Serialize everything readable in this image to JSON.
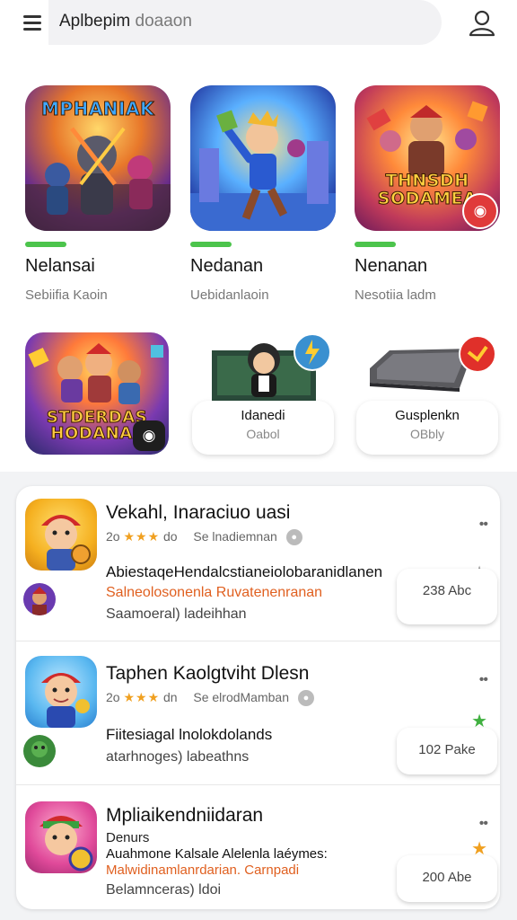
{
  "header": {
    "search_value": "Aplbepim",
    "search_placeholder": "doaaon"
  },
  "featured": [
    {
      "tile_text": "MPHANIAK",
      "name": "Nelansai",
      "sub": "Sebiifia Kaoin",
      "progress": 0.3
    },
    {
      "tile_text": "",
      "name": "Nedanan",
      "sub": "Uebidanlaoin",
      "progress": 0.3
    },
    {
      "tile_text": "THNSDH SODAMEA",
      "name": "Nenanan",
      "sub": "Nesotiia ladm",
      "progress": 0.3
    }
  ],
  "row2": {
    "tile_text": "STDERDAS HODANAL",
    "promos": [
      {
        "title": "Idanedi",
        "sub": "Oabol"
      },
      {
        "title": "Gusplenkn",
        "sub": "OBbly"
      }
    ]
  },
  "apps": [
    {
      "title": "Vekahl, Inaraciuo uasi",
      "rating_num": "2o",
      "meta_a": "do",
      "meta_b": "Se lnadiemnan",
      "desc1": "AbiestaqeHendalcstianeiolobaranidlanen",
      "desc2": "Salneolosonenla Ruvatenenranan",
      "desc3": "Saamoeral) ladeihhan",
      "price": "238 Abc"
    },
    {
      "title": "Taphen Kaolgtviht Dlesn",
      "rating_num": "2o",
      "meta_a": "dn",
      "meta_b": "Se elrodMamban",
      "desc1": "Fiitesiagal lnolokdolands",
      "desc2": "",
      "desc3": "atarhnoges) labeathns",
      "price": "102 Pake"
    },
    {
      "title": "Mpliaikendniidaran",
      "rating_num": "Denurs",
      "meta_a": "",
      "meta_b": "",
      "desc1": "Auahmone Kalsale Alelenla laéymes:",
      "desc2": "Malwidinamlanrdarian. Carnpadi",
      "desc3": "Belamnceras) ldoi",
      "price": "200 Abe"
    }
  ],
  "colors": {
    "accent_green": "#4cc44c",
    "star": "#f0a020",
    "badge_red": "#e03a3a",
    "orange_text": "#e06020"
  },
  "icons": [
    "hamburger-menu-icon",
    "profile-icon",
    "camera-icon",
    "info-icon",
    "star-icon",
    "more-icon"
  ]
}
